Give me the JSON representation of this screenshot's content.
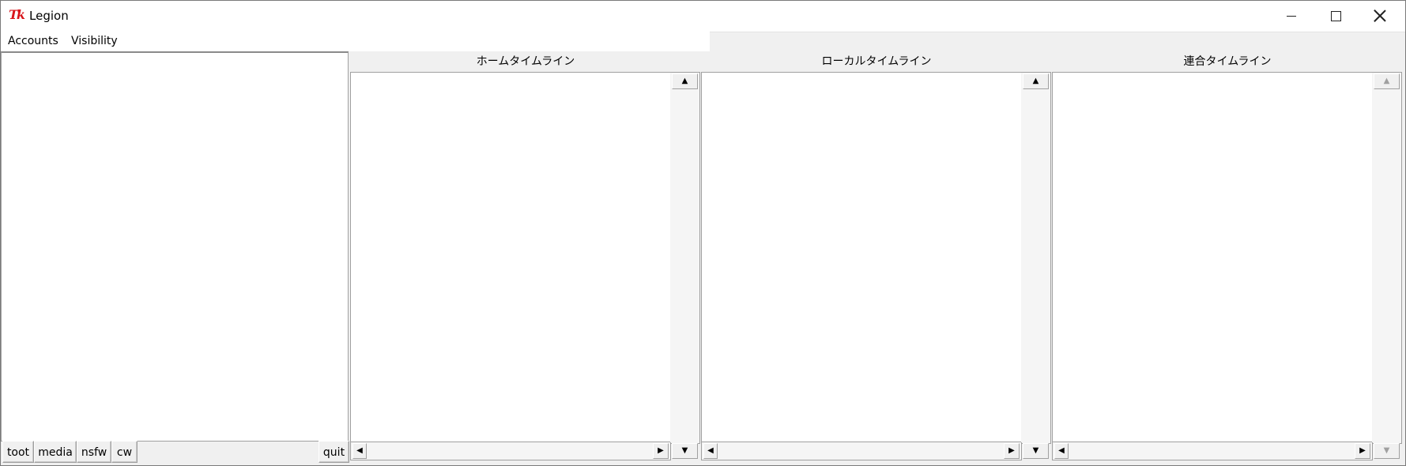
{
  "window": {
    "title": "Legion",
    "app_icon_text": "Tk",
    "app_icon_color": "#d9151b"
  },
  "menu": {
    "items": [
      {
        "label": "Accounts"
      },
      {
        "label": "Visibility"
      }
    ]
  },
  "compose": {
    "buttons": {
      "toot": "toot",
      "media": "media",
      "nsfw": "nsfw",
      "cw": "cw",
      "quit": "quit"
    }
  },
  "timelines": [
    {
      "title": "ホームタイムライン",
      "scroll_enabled": true
    },
    {
      "title": "ローカルタイムライン",
      "scroll_enabled": true
    },
    {
      "title": "連合タイムライン",
      "scroll_enabled": false
    }
  ],
  "icons": {
    "up": "▲",
    "down": "▼",
    "left": "◀",
    "right": "▶"
  }
}
